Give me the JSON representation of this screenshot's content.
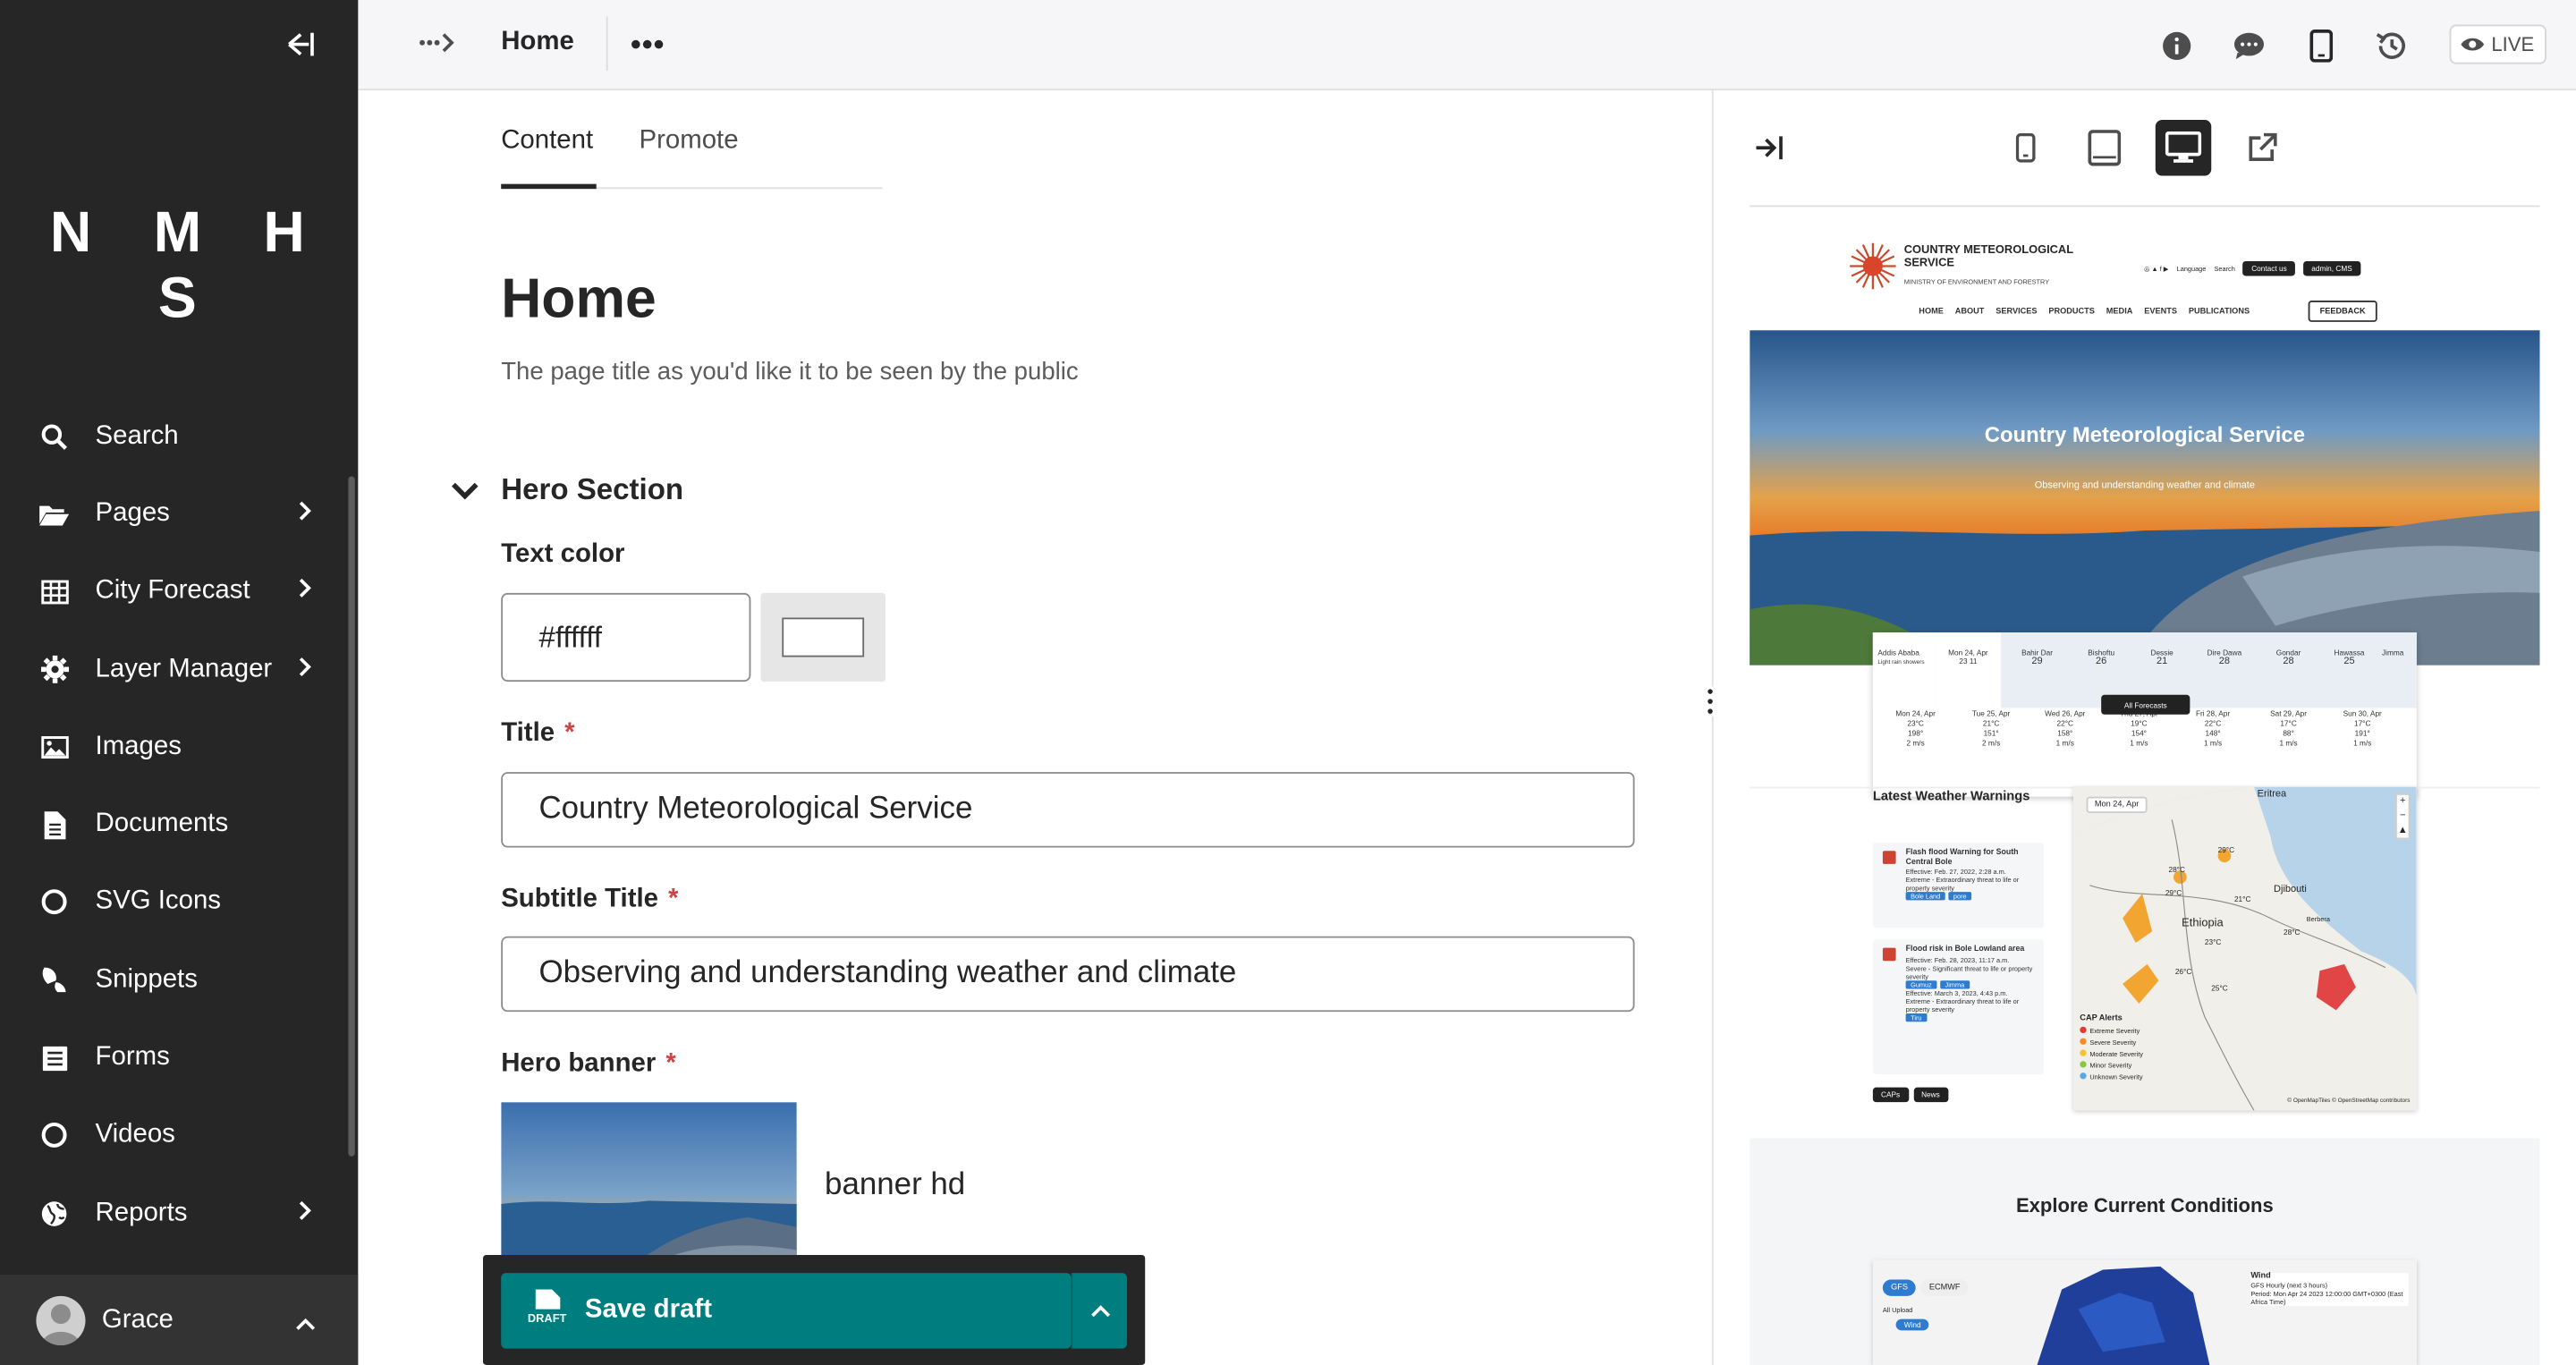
{
  "sidebar": {
    "logo": "N M H S",
    "items": [
      {
        "label": "Search",
        "icon": "search-icon",
        "has_children": false
      },
      {
        "label": "Pages",
        "icon": "folder-open-icon",
        "has_children": true
      },
      {
        "label": "City Forecast",
        "icon": "table-icon",
        "has_children": true
      },
      {
        "label": "Layer Manager",
        "icon": "cog-icon",
        "has_children": true
      },
      {
        "label": "Images",
        "icon": "image-icon",
        "has_children": false
      },
      {
        "label": "Documents",
        "icon": "document-icon",
        "has_children": false
      },
      {
        "label": "SVG Icons",
        "icon": "circle-icon",
        "has_children": false
      },
      {
        "label": "Snippets",
        "icon": "snippet-icon",
        "has_children": false
      },
      {
        "label": "Forms",
        "icon": "form-icon",
        "has_children": false
      },
      {
        "label": "Videos",
        "icon": "circle-icon",
        "has_children": false
      },
      {
        "label": "Reports",
        "icon": "globe-icon",
        "has_children": true
      }
    ],
    "user": {
      "name": "Grace"
    }
  },
  "topbar": {
    "page_name": "Home",
    "live_label": "LIVE"
  },
  "editor": {
    "tabs": [
      {
        "label": "Content",
        "active": true
      },
      {
        "label": "Promote",
        "active": false
      }
    ],
    "page_title": "Home",
    "page_title_help": "The page title as you'd like it to be seen by the public",
    "section_title": "Hero Section",
    "text_color_label": "Text color",
    "text_color_value": "#ffffff",
    "title_label": "Title",
    "title_value": "Country Meteorological Service",
    "subtitle_label": "Subtitle Title",
    "subtitle_value": "Observing and understanding weather and climate",
    "banner_label": "Hero banner",
    "banner_name": "banner hd",
    "required_mark": "*",
    "save_label": "Save draft",
    "save_icon_text": "DRAFT"
  },
  "preview": {
    "site": {
      "name": "COUNTRY METEOROLOGICAL SERVICE",
      "ministry": "MINISTRY OF ENVIRONMENT AND FORESTRY",
      "language": "Language",
      "search": "Search",
      "contact": "Contact us",
      "admin": "admin, CMS",
      "nav": [
        "HOME",
        "ABOUT",
        "SERVICES",
        "PRODUCTS",
        "MEDIA",
        "EVENTS",
        "PUBLICATIONS"
      ],
      "feedback": "FEEDBACK",
      "hero_title": "Country Meteorological Service",
      "hero_subtitle": "Observing and understanding weather and climate",
      "cities": [
        {
          "name": "Addis Ababa",
          "note": "Light rain showers"
        },
        {
          "name": "Mon 24, Apr",
          "note": "23 11"
        },
        {
          "name": "Bahir Dar",
          "note": "29"
        },
        {
          "name": "Bishoftu",
          "note": "26"
        },
        {
          "name": "Dessie",
          "note": "21"
        },
        {
          "name": "Dire Dawa",
          "note": "28"
        },
        {
          "name": "Gondar",
          "note": "28"
        },
        {
          "name": "Hawassa",
          "note": "25"
        },
        {
          "name": "Jimma",
          "note": ""
        }
      ],
      "days": [
        {
          "day": "Mon 24, Apr",
          "temp": "23°C",
          "wind": "198°",
          "speed": "2 m/s"
        },
        {
          "day": "Tue 25, Apr",
          "temp": "21°C",
          "wind": "151°",
          "speed": "2 m/s"
        },
        {
          "day": "Wed 26, Apr",
          "temp": "22°C",
          "wind": "158°",
          "speed": "1 m/s"
        },
        {
          "day": "Thu 27, Apr",
          "temp": "19°C",
          "wind": "154°",
          "speed": "1 m/s"
        },
        {
          "day": "Fri 28, Apr",
          "temp": "22°C",
          "wind": "148°",
          "speed": "1 m/s"
        },
        {
          "day": "Sat 29, Apr",
          "temp": "17°C",
          "wind": "88°",
          "speed": "1 m/s"
        },
        {
          "day": "Sun 30, Apr",
          "temp": "17°C",
          "wind": "191°",
          "speed": "1 m/s"
        }
      ],
      "all_forecasts": "All Forecasts",
      "warnings_title": "Latest Weather Warnings",
      "warnings": [
        {
          "title": "Flash flood Warning for South Central Bole",
          "effective": "Effective: Feb. 27, 2022, 2:28 a.m.",
          "desc": "Extreme - Extraordinary threat to life or property severity",
          "tags": [
            "Bole Land",
            "pore"
          ]
        },
        {
          "title": "Flood risk in Bole Lowland area",
          "effective": "Effective: Feb. 28, 2023, 11:17 a.m.",
          "desc": "Severe - Significant threat to life or property severity",
          "tags": [
            "Gumuz",
            "Jimma"
          ],
          "effective2": "Effective: March 3, 2023, 4:43 p.m.",
          "desc2": "Extreme - Extraordinary threat to life or property severity",
          "tags2": [
            "Tiru"
          ]
        }
      ],
      "map_date": "Mon 24, Apr",
      "map_country": "Ethiopia",
      "map_labels": [
        "Eritrea",
        "Djibouti",
        "Berbera"
      ],
      "map_temps": [
        "28°C",
        "29°C",
        "29°C",
        "21°C",
        "28°C",
        "23°C",
        "26°C",
        "25°C"
      ],
      "cap_title": "CAP Alerts",
      "cap_levels": [
        "Extreme Severity",
        "Severe Severity",
        "Moderate Severity",
        "Minor Severity",
        "Unknown Severity"
      ],
      "cap_colors": [
        "#e03b3b",
        "#f28c28",
        "#f4c430",
        "#8cc63f",
        "#5aa9e6"
      ],
      "attribution": "© OpenMapTiles © OpenStreetMap contributors",
      "bottom_btns": [
        "CAPs",
        "News"
      ],
      "explore_title": "Explore Current Conditions",
      "model_btns": [
        "GFS",
        "ECMWF"
      ],
      "wind_label": "Wind",
      "wind_sub": "GFS Hourly (next 3 hours)",
      "wind_period": "Period: Mon Apr 24 2023 12:00:00 GMT+0300 (East Africa Time)",
      "wind_tag": "Wind",
      "all_upload": "All Upload"
    }
  },
  "colors": {
    "sidebar_bg": "#262626",
    "primary": "#007d7e",
    "required": "#cd4444"
  }
}
